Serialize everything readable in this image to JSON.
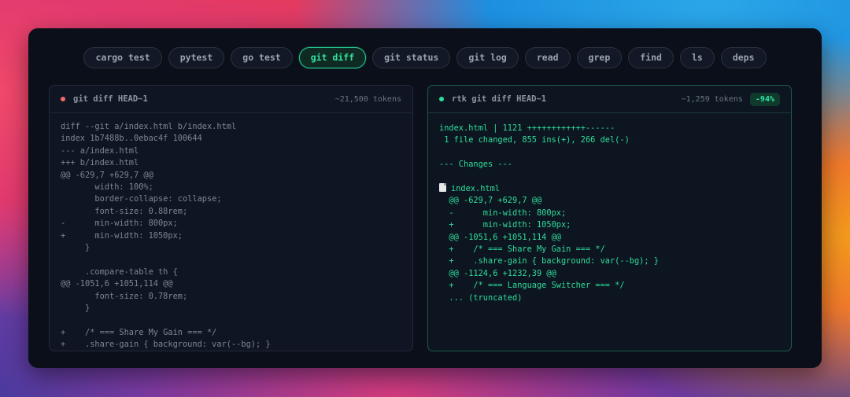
{
  "tabs": [
    {
      "label": "cargo test",
      "active": false
    },
    {
      "label": "pytest",
      "active": false
    },
    {
      "label": "go test",
      "active": false
    },
    {
      "label": "git diff",
      "active": true
    },
    {
      "label": "git status",
      "active": false
    },
    {
      "label": "git log",
      "active": false
    },
    {
      "label": "read",
      "active": false
    },
    {
      "label": "grep",
      "active": false
    },
    {
      "label": "find",
      "active": false
    },
    {
      "label": "ls",
      "active": false
    },
    {
      "label": "deps",
      "active": false
    }
  ],
  "left_panel": {
    "title": "git diff HEAD~1",
    "tokens": "~21,500 tokens",
    "dot_color": "#f26b6b",
    "lines": [
      "diff --git a/index.html b/index.html",
      "index 1b7488b..0ebac4f 100644",
      "--- a/index.html",
      "+++ b/index.html",
      "@@ -629,7 +629,7 @@",
      "       width: 100%;",
      "       border-collapse: collapse;",
      "       font-size: 0.88rem;",
      "-      min-width: 800px;",
      "+      min-width: 1050px;",
      "     }",
      "",
      "     .compare-table th {",
      "@@ -1051,6 +1051,114 @@",
      "       font-size: 0.78rem;",
      "     }",
      "",
      "+    /* === Share My Gain === */",
      "+    .share-gain { background: var(--bg); }"
    ]
  },
  "right_panel": {
    "title": "rtk git diff HEAD~1",
    "tokens": "~1,259 tokens",
    "badge": "-94%",
    "dot_color": "#2fdc9b",
    "summary_lines": [
      "index.html | 1121 ++++++++++++------",
      " 1 file changed, 855 ins(+), 266 del(-)",
      "",
      "--- Changes ---",
      ""
    ],
    "file_name": "index.html",
    "file_icon": "file-icon",
    "change_lines": [
      "  @@ -629,7 +629,7 @@",
      "  -      min-width: 800px;",
      "  +      min-width: 1050px;",
      "  @@ -1051,6 +1051,114 @@",
      "  +    /* === Share My Gain === */",
      "  +    .share-gain { background: var(--bg); }",
      "  @@ -1124,6 +1232,39 @@",
      "  +    /* === Language Switcher === */",
      "  ... (truncated)"
    ]
  }
}
